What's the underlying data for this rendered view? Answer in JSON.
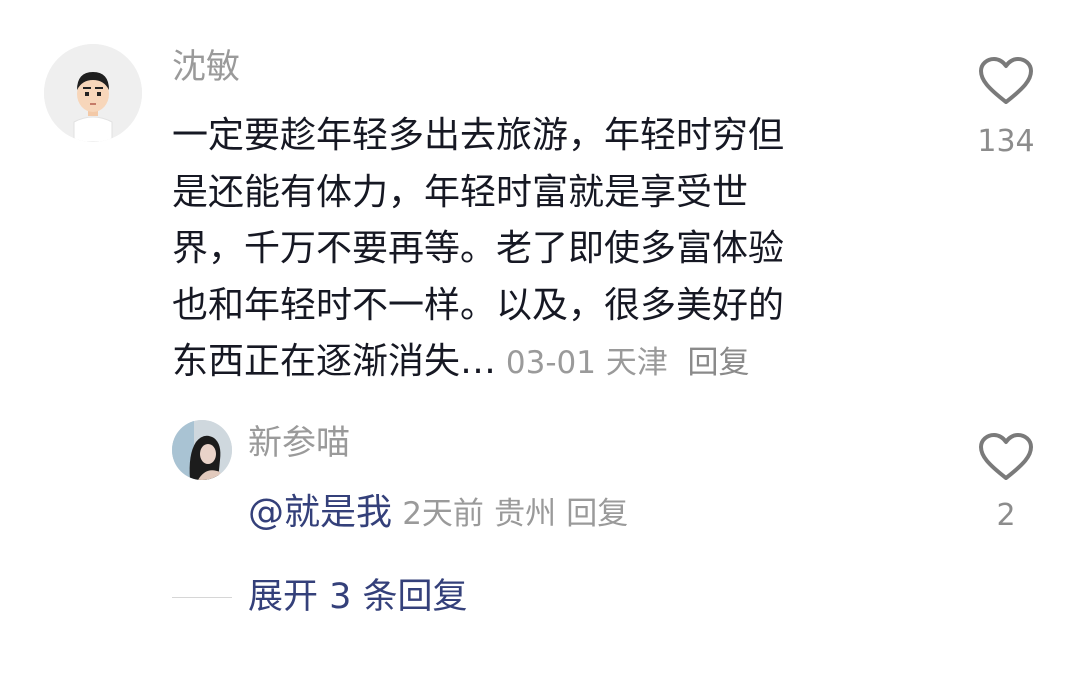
{
  "comment": {
    "author": "沈敏",
    "text_lines": [
      "一定要趁年轻多出去旅游，年轻时穷但",
      "是还能有体力，年轻时富就是享受世",
      "界，千万不要再等。老了即使多富体验",
      "也和年轻时不一样。以及，很多美好的",
      "东西正在逐渐消失…"
    ],
    "date": "03-01",
    "location": "天津",
    "reply_label": "回复",
    "like_icon": "heart-outline-icon",
    "like_count": "134"
  },
  "reply": {
    "author": "新参喵",
    "mention": "@就是我",
    "time": "2天前",
    "location": "贵州",
    "reply_label": "回复",
    "like_icon": "heart-outline-icon",
    "like_count": "2"
  },
  "expand_replies": {
    "label": "展开 3 条回复"
  },
  "colors": {
    "meta_gray": "#9a9a9a",
    "body_text": "#161823",
    "link_blue": "#34407a",
    "heart_stroke": "#7a7a7a"
  }
}
